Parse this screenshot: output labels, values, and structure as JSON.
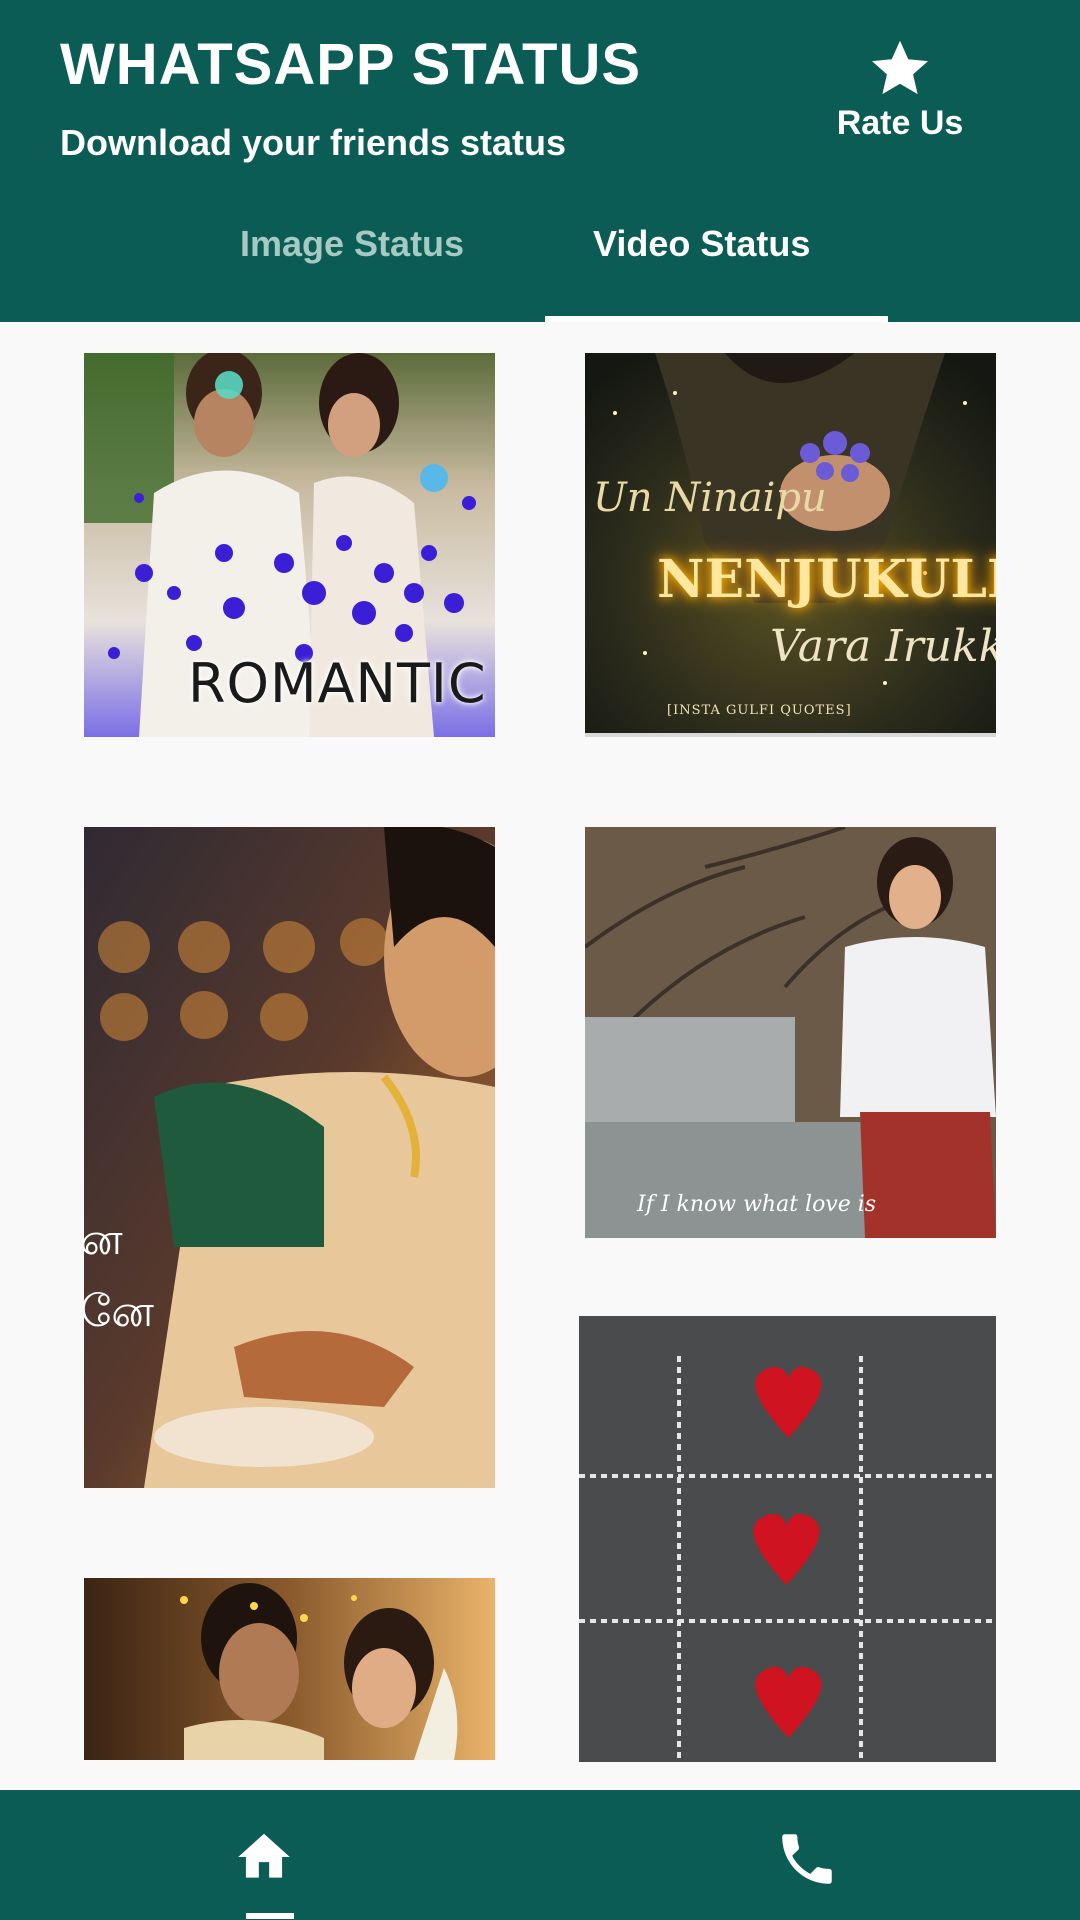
{
  "header": {
    "title": "WHATSAPP STATUS",
    "subtitle": "Download your friends status",
    "rate_us_label": "Rate Us",
    "rate_us_icon": "star-icon"
  },
  "tabs": [
    {
      "label": "Image Status",
      "selected": false
    },
    {
      "label": "Video Status",
      "selected": true
    }
  ],
  "status_grid": {
    "tiles": [
      {
        "overlay_text": "ROMANTIC"
      },
      {
        "overlay_text": [
          "Un Ninaipu",
          "NENJUKULI",
          "Vara Irukku",
          "[INSTA GULFI QUOTES]"
        ]
      },
      {
        "overlay_text": [
          "ன",
          "னே"
        ]
      },
      {
        "overlay_text": "If I know what love is"
      },
      {
        "overlay_text": ""
      },
      {
        "overlay_text": ""
      }
    ]
  },
  "bottom_nav": {
    "items": [
      {
        "icon": "home-icon",
        "active": true
      },
      {
        "icon": "phone-icon",
        "active": false
      }
    ]
  },
  "colors": {
    "primary": "#0b5c54",
    "background": "#f9f9fa",
    "tab_inactive": "#a6c9c4",
    "on_primary": "#ffffff"
  }
}
